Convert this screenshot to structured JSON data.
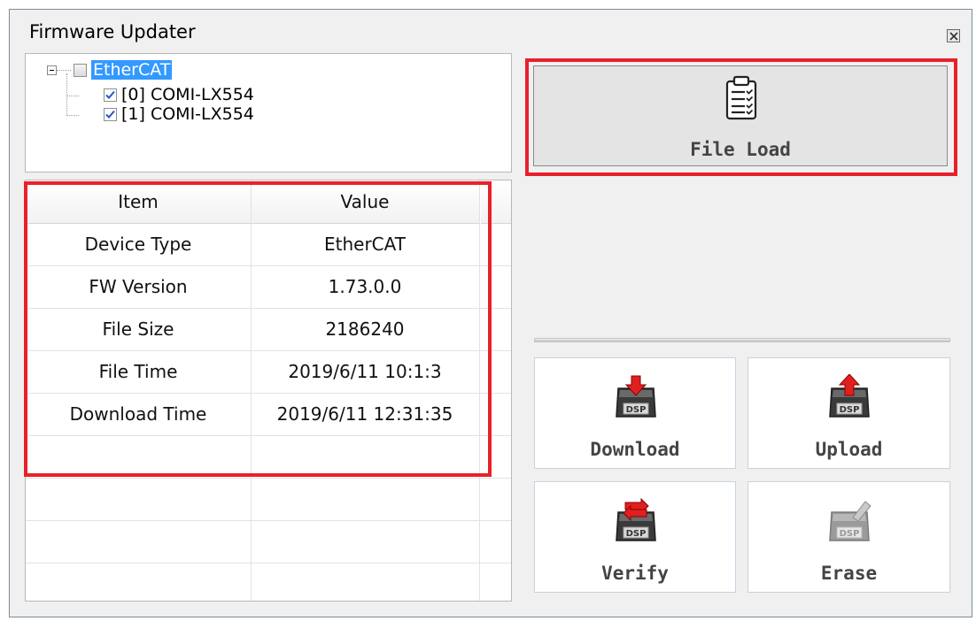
{
  "window": {
    "title": "Firmware Updater"
  },
  "tree": {
    "root": {
      "label": "EtherCAT",
      "checked": false,
      "selected": true
    },
    "children": [
      {
        "label": "[0] COMI-LX554",
        "checked": true
      },
      {
        "label": "[1] COMI-LX554",
        "checked": true
      }
    ]
  },
  "grid": {
    "headers": [
      "Item",
      "Value"
    ],
    "rows": [
      {
        "item": "Device Type",
        "value": "EtherCAT"
      },
      {
        "item": "FW Version",
        "value": "1.73.0.0"
      },
      {
        "item": "File Size",
        "value": "2186240"
      },
      {
        "item": "File Time",
        "value": "2019/6/11 10:1:3"
      },
      {
        "item": "Download Time",
        "value": "2019/6/11 12:31:35"
      }
    ]
  },
  "buttons": {
    "file_load": "File Load",
    "download": "Download",
    "upload": "Upload",
    "verify": "Verify",
    "erase": "Erase",
    "icon_badge": "DSP"
  },
  "icons": {
    "file_load": "clipboard-checklist-icon",
    "download": "dsp-download-icon",
    "upload": "dsp-upload-icon",
    "verify": "dsp-verify-icon",
    "erase": "dsp-erase-icon",
    "close": "close-icon"
  },
  "colors": {
    "highlight": "#e8202a",
    "selection": "#3399ff",
    "arrow": "#e02020"
  }
}
